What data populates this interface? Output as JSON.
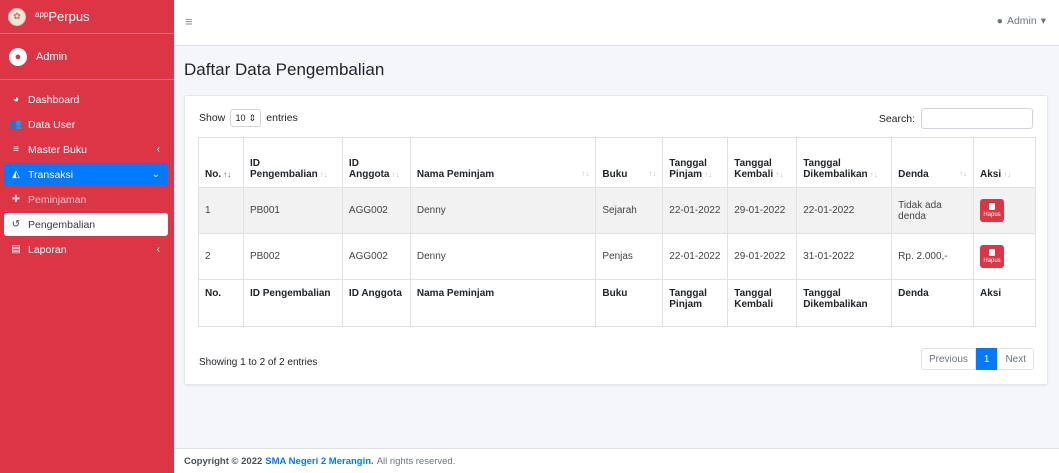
{
  "brand": {
    "sup": "app",
    "name": "Perpus"
  },
  "user": {
    "name": "Admin"
  },
  "sidebar": {
    "items": [
      {
        "label": "Dashboard",
        "icon": "dashboard-icon"
      },
      {
        "label": "Data User",
        "icon": "users-icon"
      },
      {
        "label": "Master Buku",
        "icon": "database-icon"
      },
      {
        "label": "Transaksi",
        "icon": "chart-area-icon"
      },
      {
        "label": "Peminjaman",
        "icon": "plus-icon"
      },
      {
        "label": "Pengembalian",
        "icon": "undo-icon"
      },
      {
        "label": "Laporan",
        "icon": "file-icon"
      }
    ]
  },
  "topbar": {
    "admin_label": "Admin"
  },
  "page": {
    "title": "Daftar Data Pengembalian"
  },
  "table_controls": {
    "show_label": "Show",
    "page_size": "10",
    "entries_label": "entries",
    "search_label": "Search:",
    "search_value": ""
  },
  "table": {
    "headers": [
      "No.",
      "ID Pengembalian",
      "ID Anggota",
      "Nama Peminjam",
      "Buku",
      "Tanggal Pinjam",
      "Tanggal Kembali",
      "Tanggal Dikembalikan",
      "Denda",
      "Aksi"
    ],
    "rows": [
      {
        "no": "1",
        "id_pengembalian": "PB001",
        "id_anggota": "AGG002",
        "nama": "Denny",
        "buku": "Sejarah",
        "tgl_pinjam": "22-01-2022",
        "tgl_kembali": "29-01-2022",
        "tgl_dikembalikan": "22-01-2022",
        "denda": "Tidak ada denda",
        "aksi": "Hapus"
      },
      {
        "no": "2",
        "id_pengembalian": "PB002",
        "id_anggota": "AGG002",
        "nama": "Denny",
        "buku": "Penjas",
        "tgl_pinjam": "22-01-2022",
        "tgl_kembali": "29-01-2022",
        "tgl_dikembalikan": "31-01-2022",
        "denda": "Rp. 2.000,-",
        "aksi": "Hapus"
      }
    ]
  },
  "pagination": {
    "info": "Showing 1 to 2 of 2 entries",
    "previous": "Previous",
    "current": "1",
    "next": "Next"
  },
  "footer": {
    "copyright": "Copyright © 2022",
    "school": "SMA Negeri 2 Merangin.",
    "rights": "All rights reserved."
  },
  "colors": {
    "sidebar": "#dc3545",
    "accent": "#007bff"
  }
}
